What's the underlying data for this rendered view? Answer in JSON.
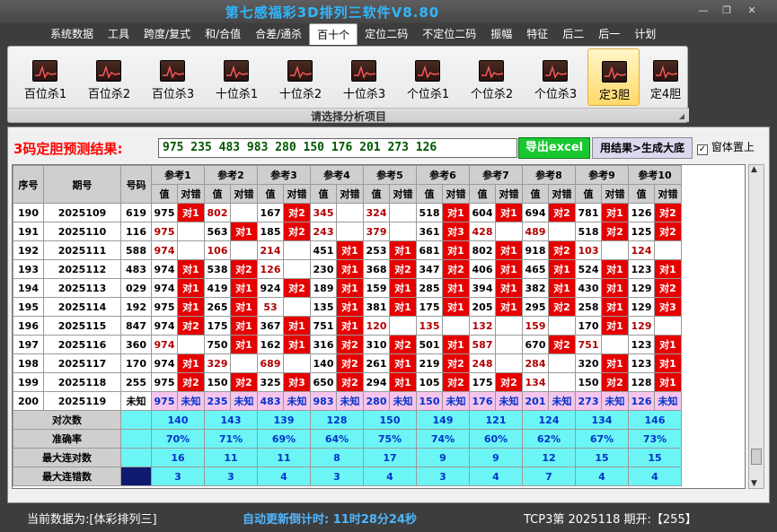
{
  "window": {
    "title": "第七感福彩3D排列三软件V8.80",
    "min": "—",
    "max": "❐",
    "close": "✕"
  },
  "menu": [
    "系统数据",
    "工具",
    "跨度/复式",
    "和/合值",
    "合差/通杀",
    "百十个",
    "定位二码",
    "不定位二码",
    "振幅",
    "特征",
    "后二",
    "后一",
    "计划"
  ],
  "menu_active": 5,
  "ribbon": {
    "items": [
      "百位杀1",
      "百位杀2",
      "百位杀3",
      "十位杀1",
      "十位杀2",
      "十位杀3",
      "个位杀1",
      "个位杀2",
      "个位杀3",
      "定3胆",
      "定4胆"
    ],
    "selected": 9,
    "caption": "请选择分析项目",
    "icon": "chart-icon"
  },
  "prediction": {
    "label": "3码定胆预测结果:",
    "value": "975 235 483 983 280 150 176 201 273 126",
    "export_label": "导出excel",
    "generate_label": "用结果>生成大底",
    "topmost_label": "窗体置上",
    "topmost_checked": "✓"
  },
  "table": {
    "headers": [
      "序号",
      "期号",
      "号码"
    ],
    "groups": [
      "参考1",
      "参考2",
      "参考3",
      "参考4",
      "参考5",
      "参考6",
      "参考7",
      "参考8",
      "参考9",
      "参考10"
    ],
    "sub": [
      "值",
      "对错"
    ],
    "rows": [
      {
        "seq": "190",
        "issue": "2025109",
        "num": "619",
        "cells": [
          [
            "975",
            "v",
            "对1"
          ],
          [
            "802",
            "vr",
            ""
          ],
          [
            "167",
            "v",
            "对2"
          ],
          [
            "345",
            "vr",
            ""
          ],
          [
            "324",
            "vr",
            ""
          ],
          [
            "518",
            "v",
            "对1"
          ],
          [
            "604",
            "v",
            "对1"
          ],
          [
            "694",
            "v",
            "对2"
          ],
          [
            "781",
            "v",
            "对1"
          ],
          [
            "126",
            "v",
            "对2"
          ]
        ]
      },
      {
        "seq": "191",
        "issue": "2025110",
        "num": "116",
        "cells": [
          [
            "975",
            "vr",
            ""
          ],
          [
            "563",
            "v",
            "对1"
          ],
          [
            "185",
            "v",
            "对2"
          ],
          [
            "243",
            "vr",
            ""
          ],
          [
            "379",
            "vr",
            ""
          ],
          [
            "361",
            "v",
            "对3"
          ],
          [
            "428",
            "vr",
            ""
          ],
          [
            "489",
            "vr",
            ""
          ],
          [
            "518",
            "v",
            "对2"
          ],
          [
            "125",
            "v",
            "对2"
          ]
        ]
      },
      {
        "seq": "192",
        "issue": "2025111",
        "num": "588",
        "cells": [
          [
            "974",
            "vr",
            ""
          ],
          [
            "106",
            "vr",
            ""
          ],
          [
            "214",
            "vr",
            ""
          ],
          [
            "451",
            "v",
            "对1"
          ],
          [
            "253",
            "v",
            "对1"
          ],
          [
            "681",
            "v",
            "对1"
          ],
          [
            "802",
            "v",
            "对1"
          ],
          [
            "918",
            "v",
            "对2"
          ],
          [
            "103",
            "vr",
            ""
          ],
          [
            "124",
            "vr",
            ""
          ]
        ]
      },
      {
        "seq": "193",
        "issue": "2025112",
        "num": "483",
        "cells": [
          [
            "974",
            "v",
            "对1"
          ],
          [
            "538",
            "v",
            "对2"
          ],
          [
            "126",
            "vr",
            ""
          ],
          [
            "230",
            "v",
            "对1"
          ],
          [
            "368",
            "v",
            "对2"
          ],
          [
            "347",
            "v",
            "对2"
          ],
          [
            "406",
            "v",
            "对1"
          ],
          [
            "465",
            "v",
            "对1"
          ],
          [
            "524",
            "v",
            "对1"
          ],
          [
            "123",
            "v",
            "对1"
          ]
        ]
      },
      {
        "seq": "194",
        "issue": "2025113",
        "num": "029",
        "cells": [
          [
            "974",
            "v",
            "对1"
          ],
          [
            "419",
            "v",
            "对1"
          ],
          [
            "924",
            "v",
            "对2"
          ],
          [
            "189",
            "v",
            "对1"
          ],
          [
            "159",
            "v",
            "对1"
          ],
          [
            "285",
            "v",
            "对1"
          ],
          [
            "394",
            "v",
            "对1"
          ],
          [
            "382",
            "v",
            "对1"
          ],
          [
            "430",
            "v",
            "对1"
          ],
          [
            "129",
            "v",
            "对2"
          ]
        ]
      },
      {
        "seq": "195",
        "issue": "2025114",
        "num": "192",
        "cells": [
          [
            "975",
            "v",
            "对1"
          ],
          [
            "265",
            "v",
            "对1"
          ],
          [
            "53",
            "vr",
            ""
          ],
          [
            "135",
            "v",
            "对1"
          ],
          [
            "381",
            "v",
            "对1"
          ],
          [
            "175",
            "v",
            "对1"
          ],
          [
            "205",
            "v",
            "对1"
          ],
          [
            "295",
            "v",
            "对2"
          ],
          [
            "258",
            "v",
            "对1"
          ],
          [
            "129",
            "v",
            "对3"
          ]
        ]
      },
      {
        "seq": "196",
        "issue": "2025115",
        "num": "847",
        "cells": [
          [
            "974",
            "v",
            "对2"
          ],
          [
            "175",
            "v",
            "对1"
          ],
          [
            "367",
            "v",
            "对1"
          ],
          [
            "751",
            "v",
            "对1"
          ],
          [
            "120",
            "vr",
            ""
          ],
          [
            "135",
            "vr",
            ""
          ],
          [
            "132",
            "vr",
            ""
          ],
          [
            "159",
            "vr",
            ""
          ],
          [
            "170",
            "v",
            "对1"
          ],
          [
            "129",
            "vr",
            ""
          ]
        ]
      },
      {
        "seq": "197",
        "issue": "2025116",
        "num": "360",
        "cells": [
          [
            "974",
            "vr",
            ""
          ],
          [
            "750",
            "v",
            "对1"
          ],
          [
            "162",
            "v",
            "对1"
          ],
          [
            "316",
            "v",
            "对2"
          ],
          [
            "310",
            "v",
            "对2"
          ],
          [
            "501",
            "v",
            "对1"
          ],
          [
            "587",
            "vr",
            ""
          ],
          [
            "670",
            "v",
            "对2"
          ],
          [
            "751",
            "vr",
            ""
          ],
          [
            "123",
            "v",
            "对1"
          ]
        ]
      },
      {
        "seq": "198",
        "issue": "2025117",
        "num": "170",
        "cells": [
          [
            "974",
            "v",
            "对1"
          ],
          [
            "329",
            "vr",
            ""
          ],
          [
            "689",
            "vr",
            ""
          ],
          [
            "140",
            "v",
            "对2"
          ],
          [
            "261",
            "v",
            "对1"
          ],
          [
            "219",
            "v",
            "对2"
          ],
          [
            "248",
            "vr",
            ""
          ],
          [
            "284",
            "vr",
            ""
          ],
          [
            "320",
            "v",
            "对1"
          ],
          [
            "123",
            "v",
            "对1"
          ]
        ]
      },
      {
        "seq": "199",
        "issue": "2025118",
        "num": "255",
        "cells": [
          [
            "975",
            "v",
            "对2"
          ],
          [
            "150",
            "v",
            "对2"
          ],
          [
            "325",
            "v",
            "对3"
          ],
          [
            "650",
            "v",
            "对2"
          ],
          [
            "294",
            "v",
            "对1"
          ],
          [
            "105",
            "v",
            "对2"
          ],
          [
            "175",
            "v",
            "对2"
          ],
          [
            "134",
            "vr",
            ""
          ],
          [
            "150",
            "v",
            "对2"
          ],
          [
            "128",
            "v",
            "对1"
          ]
        ]
      }
    ],
    "last": {
      "seq": "200",
      "issue": "2025119",
      "num": "未知",
      "values": [
        "975",
        "235",
        "483",
        "983",
        "280",
        "150",
        "176",
        "201",
        "273",
        "126"
      ],
      "status": "未知"
    },
    "stats": [
      {
        "label": "对次数",
        "values": [
          "140",
          "143",
          "139",
          "128",
          "150",
          "149",
          "121",
          "124",
          "134",
          "146"
        ]
      },
      {
        "label": "准确率",
        "values": [
          "70%",
          "71%",
          "69%",
          "64%",
          "75%",
          "74%",
          "60%",
          "62%",
          "67%",
          "73%"
        ]
      },
      {
        "label": "最大连对数",
        "values": [
          "16",
          "11",
          "11",
          "8",
          "17",
          "9",
          "9",
          "12",
          "15",
          "15"
        ]
      },
      {
        "label": "最大连错数",
        "values": [
          "3",
          "3",
          "4",
          "3",
          "4",
          "3",
          "4",
          "7",
          "4",
          "4"
        ]
      }
    ]
  },
  "status": {
    "source": "当前数据为:[体彩排列三]",
    "timer": "自动更新倒计时:  11时28分24秒",
    "issue": "TCP3第 2025118 期开:【255】"
  },
  "colors": {
    "accent": "#2fb7ff",
    "hit": "#e60000",
    "stat_bg": "#6cf5f5",
    "pending_bg": "#f6c4ec"
  }
}
